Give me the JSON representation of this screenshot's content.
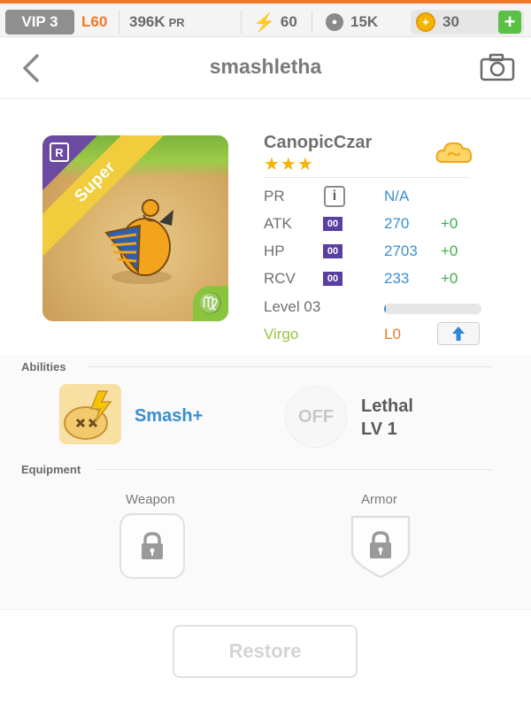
{
  "topbar": {
    "vip": "VIP 3",
    "level": "L60",
    "pr_value": "396K",
    "pr_unit": "PR",
    "energy": "60",
    "paw": "15K",
    "coins": "30",
    "add_label": "+"
  },
  "header": {
    "title": "smashletha"
  },
  "character": {
    "name": "CanopicCzar",
    "stars": "★★★",
    "rarity_badge": "R",
    "tier_ribbon": "Super",
    "zodiac_symbol": "♍",
    "stats": {
      "pr": {
        "label": "PR",
        "info_icon": "i",
        "value": "N/A"
      },
      "atk": {
        "label": "ATK",
        "icon": "00",
        "value": "270",
        "bonus": "+0"
      },
      "hp": {
        "label": "HP",
        "icon": "00",
        "value": "2703",
        "bonus": "+0"
      },
      "rcv": {
        "label": "RCV",
        "icon": "00",
        "value": "233",
        "bonus": "+0"
      }
    },
    "level_label": "Level 03",
    "level_progress": 0.02,
    "zodiac": "Virgo",
    "limit": "L0"
  },
  "abilities": {
    "section_label": "Abilities",
    "primary": {
      "name": "Smash+"
    },
    "secondary": {
      "state": "OFF",
      "name": "Lethal",
      "level": "LV 1"
    }
  },
  "equipment": {
    "section_label": "Equipment",
    "weapon_label": "Weapon",
    "armor_label": "Armor"
  },
  "actions": {
    "restore_label": "Restore"
  },
  "colors": {
    "accent_orange": "#f0782a",
    "stat_blue": "#3a8fd0",
    "bonus_green": "#3fae4c",
    "zodiac_green": "#9ac53a",
    "star_gold": "#f5b400"
  }
}
